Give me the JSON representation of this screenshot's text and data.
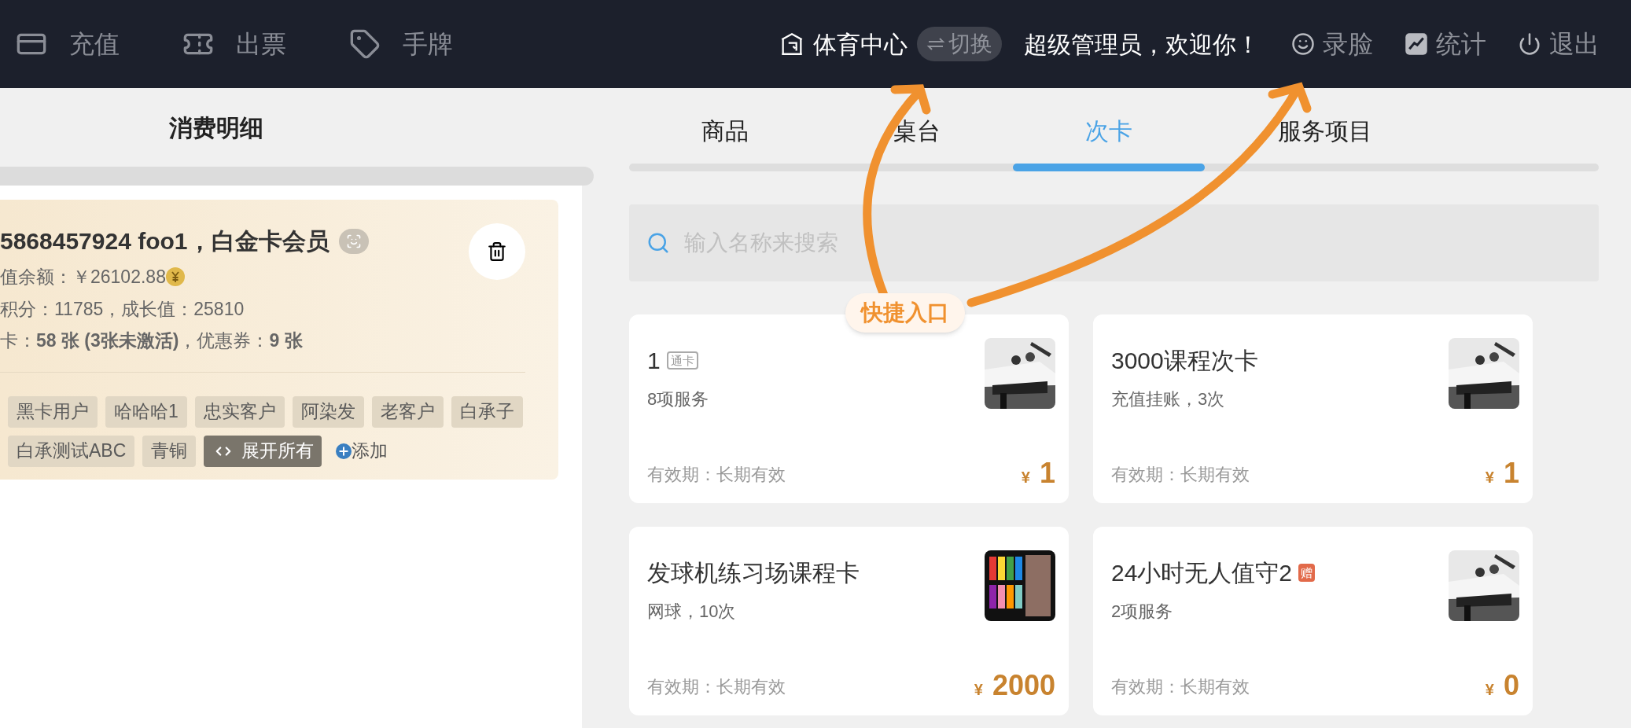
{
  "top_bar": {
    "left_items": [
      {
        "kind": "card",
        "label": "充值"
      },
      {
        "kind": "ticket",
        "label": "出票"
      },
      {
        "kind": "tag",
        "label": "手牌"
      }
    ],
    "venue": {
      "name": "体育中心",
      "switch_label": "切换"
    },
    "greeting": "超级管理员，欢迎你！",
    "right_items": [
      {
        "kind": "face",
        "label": "录脸"
      },
      {
        "kind": "chart",
        "label": "统计"
      },
      {
        "kind": "power",
        "label": "退出"
      }
    ]
  },
  "left_panel": {
    "title": "消费明细",
    "member": {
      "title": "5868457924 foo1，白金卡会员",
      "balance": "值余额：￥26102.88",
      "points": "积分：11785，成长值：25810",
      "cards": "卡：**58 张 (3张未激活)**，优惠券：**9 张**"
    },
    "tags": [
      "黑卡用户",
      "哈哈哈1",
      "忠实客户",
      "阿染发",
      "老客户",
      "白承子",
      "白承测试ABC",
      "青铜"
    ],
    "expand_label": "展开所有",
    "add_label": "添加"
  },
  "tabs": [
    {
      "label": "商品",
      "selected": false
    },
    {
      "label": "桌台",
      "selected": false
    },
    {
      "label": "次卡",
      "selected": true
    },
    {
      "label": "服务项目",
      "selected": false
    }
  ],
  "search": {
    "placeholder": "输入名称来搜索"
  },
  "cards": [
    {
      "title": "1",
      "badge": {
        "kind": "outline",
        "text": "通卡"
      },
      "subtitle": "8项服务",
      "validity": "有效期：长期有效",
      "currency": "¥",
      "price": "1"
    },
    {
      "title": "3000课程次卡",
      "subtitle": "充值挂账，3次",
      "validity": "有效期：长期有效",
      "currency": "¥",
      "price": "1"
    },
    {
      "title": "发球机练习场课程卡",
      "subtitle": "网球，10次",
      "validity": "有效期：长期有效",
      "currency": "¥",
      "price": "2000"
    },
    {
      "title": "24小时无人值守2",
      "badge": {
        "kind": "gift",
        "text": "赠"
      },
      "subtitle": "2项服务",
      "validity": "有效期：长期有效",
      "currency": "¥",
      "price": "0"
    }
  ],
  "annotation": {
    "label": "快捷入口"
  }
}
